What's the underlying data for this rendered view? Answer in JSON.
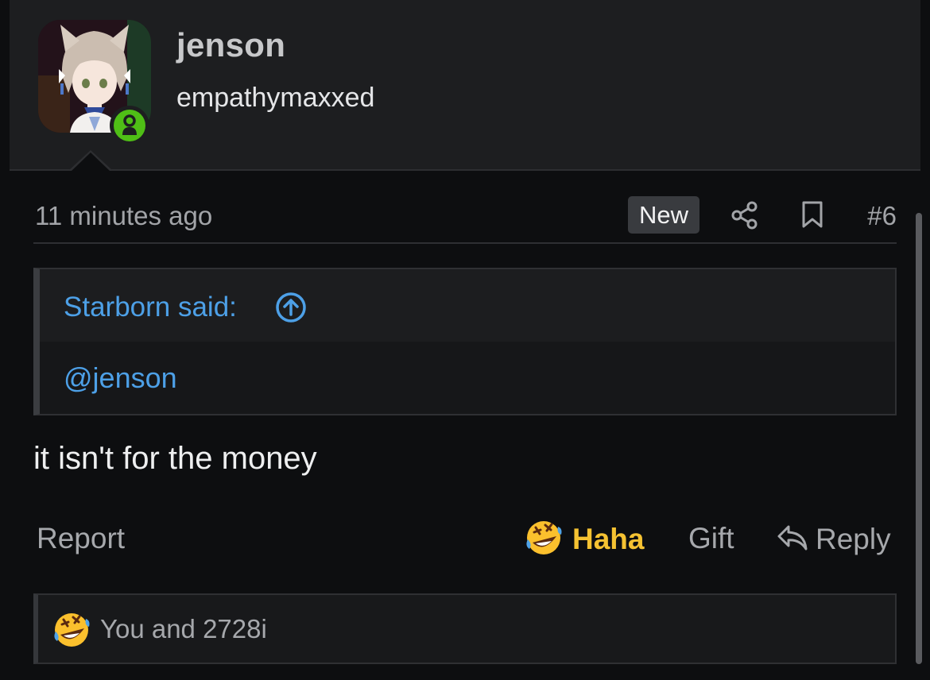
{
  "user": {
    "username": "jenson",
    "title": "empathymaxxed",
    "online": true
  },
  "post": {
    "timestamp": "11 minutes ago",
    "new_badge": "New",
    "number": "#6",
    "quote": {
      "author": "Starborn said:",
      "text": "@jenson"
    },
    "message": "it isn't for the money"
  },
  "actions": {
    "report": "Report",
    "reaction": "Haha",
    "gift": "Gift",
    "reply": "Reply"
  },
  "reactions": {
    "summary": "You and 2728i",
    "emoji": "rofl-icon"
  },
  "colors": {
    "background": "#0d0e10",
    "user_block": "#1d1e20",
    "link": "#4da0e7",
    "reaction_accent": "#f5c232",
    "online": "#4fbf16"
  }
}
